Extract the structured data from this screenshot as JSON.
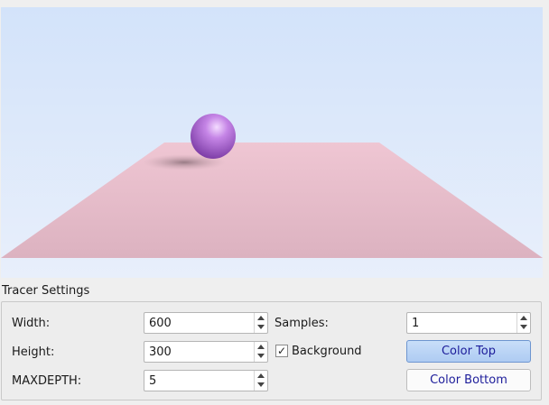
{
  "scene": {
    "sky_top_color": "#d3e3fa",
    "sky_bottom_color": "#e6eefb",
    "floor_color": "#e8bfcc",
    "sphere_color": "#b56fd6"
  },
  "settings": {
    "group_title": "Tracer Settings",
    "width": {
      "label": "Width:",
      "value": "600"
    },
    "height": {
      "label": "Height:",
      "value": "300"
    },
    "maxdepth": {
      "label": "MAXDEPTH:",
      "value": "5"
    },
    "samples": {
      "label": "Samples:",
      "value": "1"
    },
    "background": {
      "label": "Background",
      "checked": true,
      "mark": "✓"
    },
    "color_top_label": "Color Top",
    "color_bottom_label": "Color Bottom"
  }
}
